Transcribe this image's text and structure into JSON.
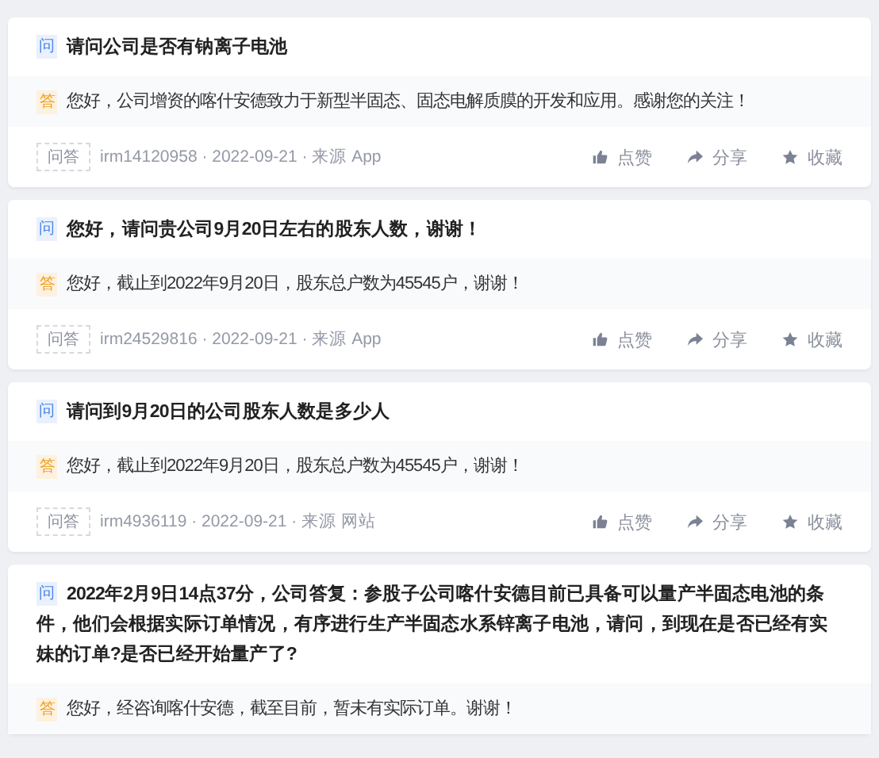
{
  "qa_list": [
    {
      "question_badge": "问",
      "question": "请问公司是否有钠离子电池",
      "answer_badge": "答",
      "answer": "您好，公司增资的喀什安德致力于新型半固态、固态电解质膜的开发和应用。感谢您的关注！",
      "footer": {
        "tag": "问答",
        "meta": "irm14120958 · 2022-09-21 · 来源 App",
        "actions": [
          {
            "kind": "like",
            "label": "点赞"
          },
          {
            "kind": "share",
            "label": "分享"
          },
          {
            "kind": "favorite",
            "label": "收藏"
          }
        ]
      }
    },
    {
      "question_badge": "问",
      "question": "您好，请问贵公司9月20日左右的股东人数，谢谢！",
      "answer_badge": "答",
      "answer": "您好，截止到2022年9月20日，股东总户数为45545户，谢谢！",
      "footer": {
        "tag": "问答",
        "meta": "irm24529816 · 2022-09-21 · 来源 App",
        "actions": [
          {
            "kind": "like",
            "label": "点赞"
          },
          {
            "kind": "share",
            "label": "分享"
          },
          {
            "kind": "favorite",
            "label": "收藏"
          }
        ]
      }
    },
    {
      "question_badge": "问",
      "question": "请问到9月20日的公司股东人数是多少人",
      "answer_badge": "答",
      "answer": "您好，截止到2022年9月20日，股东总户数为45545户，谢谢！",
      "footer": {
        "tag": "问答",
        "meta": "irm4936119 · 2022-09-21 · 来源 网站",
        "actions": [
          {
            "kind": "like",
            "label": "点赞"
          },
          {
            "kind": "share",
            "label": "分享"
          },
          {
            "kind": "favorite",
            "label": "收藏"
          }
        ]
      }
    },
    {
      "question_badge": "问",
      "question": "2022年2月9日14点37分，公司答复：参股子公司喀什安德目前已具备可以量产半固态电池的条件，他们会根据实际订单情况，有序进行生产半固态水系锌离子电池，请问，到现在是否已经有实妹的订单?是否已经开始量产了?",
      "answer_badge": "答",
      "answer": "您好，经咨询喀什安德，截至目前，暂未有实际订单。谢谢！"
    }
  ]
}
